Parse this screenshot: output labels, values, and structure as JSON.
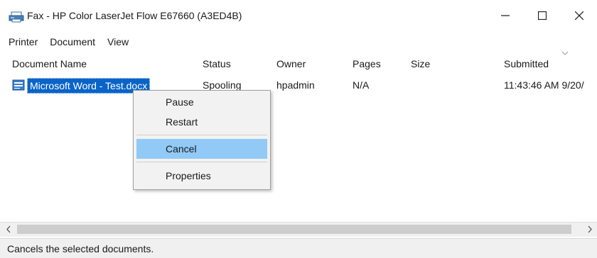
{
  "window": {
    "title": "Fax - HP Color LaserJet Flow E67660 (A3ED4B)",
    "controls": {
      "minimize": "—",
      "maximize": "☐",
      "close": "✕"
    }
  },
  "menubar": {
    "items": [
      "Printer",
      "Document",
      "View"
    ]
  },
  "table": {
    "columns": [
      "Document Name",
      "Status",
      "Owner",
      "Pages",
      "Size",
      "Submitted"
    ],
    "rows": [
      {
        "document_name": "Microsoft Word - Test.docx",
        "status": "Spooling",
        "owner": "hpadmin",
        "pages": "N/A",
        "size": "",
        "submitted": "11:43:46 AM 9/20/"
      }
    ]
  },
  "context_menu": {
    "items": [
      "Pause",
      "Restart",
      "Cancel",
      "Properties"
    ],
    "highlighted": "Cancel"
  },
  "scrollbar": {
    "left_arrow": "<",
    "right_arrow": ">"
  },
  "statusbar": {
    "text": "Cancels the selected documents."
  },
  "colors": {
    "selection": "#0a64c8",
    "menu_highlight": "#91c9f7",
    "menu_bg": "#f2f2f2",
    "statusbar_bg": "#f0f0f0"
  },
  "icons": {
    "title": "fax-printer-icon",
    "document": "document-icon"
  }
}
